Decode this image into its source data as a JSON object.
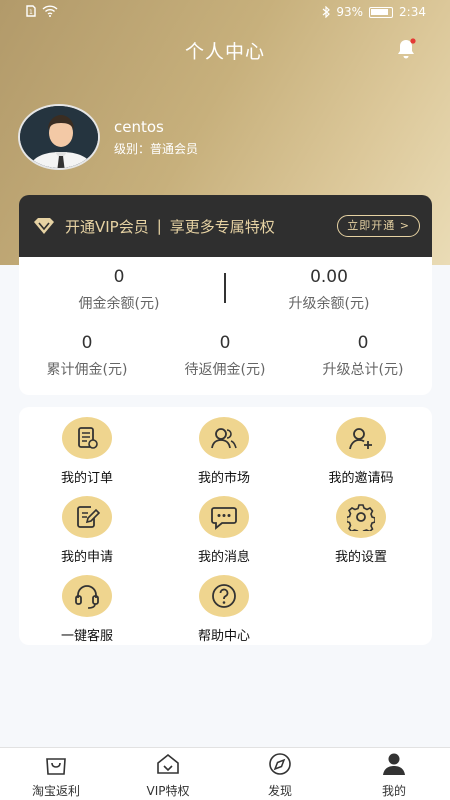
{
  "status_bar": {
    "battery_text": "93%",
    "time": "2:34"
  },
  "header": {
    "title": "个人中心"
  },
  "profile": {
    "username": "centos",
    "level_label": "级别：",
    "level_value": "普通会员"
  },
  "vip": {
    "text": "开通VIP会员",
    "separator": "|",
    "subtext": "享更多专属特权",
    "button_label": "立即开通",
    "button_arrow": ">",
    "color": "#e6d2a3"
  },
  "stats": {
    "row1": [
      {
        "value": "0",
        "label": "佣金余额(元)"
      },
      {
        "value": "0.00",
        "label": "升级余额(元)"
      }
    ],
    "row2": [
      {
        "value": "0",
        "label": "累计佣金(元)"
      },
      {
        "value": "0",
        "label": "待返佣金(元)"
      },
      {
        "value": "0",
        "label": "升级总计(元)"
      }
    ]
  },
  "menu": {
    "items": [
      {
        "label": "我的订单",
        "icon": "order-icon"
      },
      {
        "label": "我的市场",
        "icon": "team-icon"
      },
      {
        "label": "我的邀请码",
        "icon": "invite-user-icon"
      },
      {
        "label": "我的申请",
        "icon": "edit-document-icon"
      },
      {
        "label": "我的消息",
        "icon": "message-icon"
      },
      {
        "label": "我的设置",
        "icon": "gear-icon"
      },
      {
        "label": "一键客服",
        "icon": "headset-icon"
      },
      {
        "label": "帮助中心",
        "icon": "help-icon"
      }
    ],
    "icon_bg": "#efd58f"
  },
  "tabbar": {
    "tabs": [
      {
        "label": "淘宝返利",
        "icon": "shopping-bag-icon"
      },
      {
        "label": "VIP特权",
        "icon": "vip-house-icon"
      },
      {
        "label": "发现",
        "icon": "compass-icon"
      },
      {
        "label": "我的",
        "icon": "person-icon",
        "active": true
      }
    ]
  }
}
